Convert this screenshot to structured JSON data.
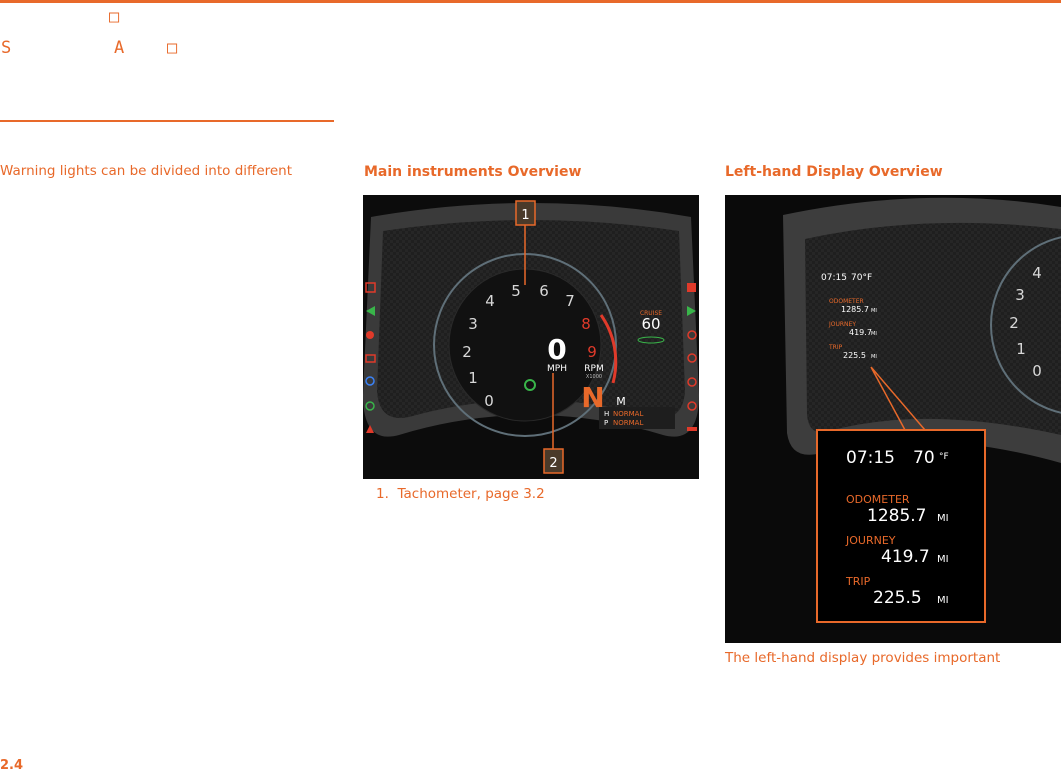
{
  "header": {
    "glyphs": [
      "□",
      "S",
      "A",
      "□"
    ]
  },
  "intro": {
    "text": "Warning lights can be divided into different"
  },
  "main_instruments": {
    "heading": "Main instruments Overview",
    "callouts": [
      "1",
      "2"
    ],
    "tach_numbers": [
      "0",
      "1",
      "2",
      "3",
      "4",
      "5",
      "6",
      "7",
      "8",
      "9"
    ],
    "speed_value": "0",
    "speed_unit": "MPH",
    "rpm_label": "RPM",
    "rpm_multiplier": "X1000",
    "gear": "N",
    "gear_mode": "M",
    "cruise_label": "CRUISE",
    "cruise_value": "60",
    "handling_label": "H",
    "handling_value": "NORMAL",
    "powertrain_label": "P",
    "powertrain_value": "NORMAL",
    "caption_number": "1.",
    "caption_text": "Tachometer, page 3.2"
  },
  "left_display": {
    "heading": "Left-hand Display Overview",
    "small": {
      "time": "07:15",
      "temp": "70°F",
      "odometer_label": "ODOMETER",
      "odometer_value": "1285.7",
      "journey_label": "JOURNEY",
      "journey_value": "419.7",
      "trip_label": "TRIP",
      "trip_value": "225.5",
      "unit": "MI"
    },
    "zoom": {
      "time": "07:15",
      "temp_value": "70",
      "temp_unit": "°F",
      "odometer_label": "ODOMETER",
      "odometer_value": "1285.7",
      "journey_label": "JOURNEY",
      "journey_value": "419.7",
      "trip_label": "TRIP",
      "trip_value": "225.5",
      "unit": "MI"
    },
    "tach_numbers": [
      "0",
      "1",
      "2",
      "3",
      "4"
    ],
    "caption": "The left-hand display provides important"
  },
  "footer": {
    "page_number": "2.4"
  },
  "colors": {
    "accent": "#e8692a",
    "warning_red": "#e03a2a",
    "indicator_green": "#39b54a"
  }
}
